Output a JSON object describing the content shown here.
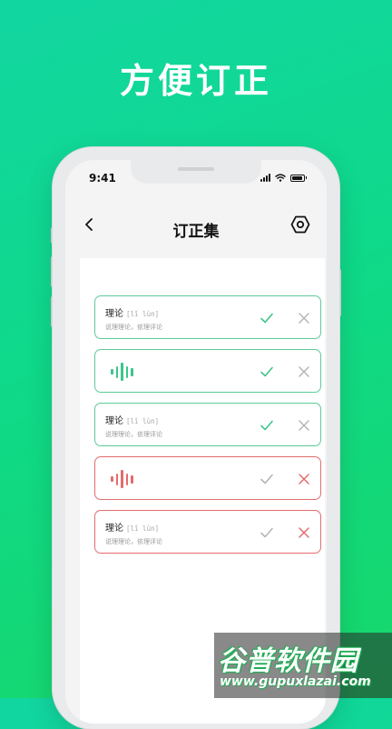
{
  "headline": "方便订正",
  "status_bar": {
    "time": "9:41"
  },
  "nav": {
    "title": "订正集"
  },
  "cards": [
    {
      "type": "word",
      "state": "correct",
      "word": "理论",
      "pinyin": "[lǐ lùn]",
      "definition": "说理理论，依理评论"
    },
    {
      "type": "audio",
      "state": "correct"
    },
    {
      "type": "word",
      "state": "correct",
      "word": "理论",
      "pinyin": "[lǐ lùn]",
      "definition": "说理理论，依理评论"
    },
    {
      "type": "audio",
      "state": "wrong"
    },
    {
      "type": "word",
      "state": "wrong",
      "word": "理论",
      "pinyin": "[lǐ lùn]",
      "definition": "说理理论，依理评论"
    }
  ],
  "icons": {
    "back": "chevron-left-icon",
    "settings": "hexagon-settings-icon",
    "correct": "check-icon",
    "wrong": "close-icon",
    "audio": "sound-wave-icon"
  },
  "colors": {
    "background_start": "#12d6a1",
    "background_end": "#17d86a",
    "correct_accent": "#3cc58a",
    "wrong_accent": "#e46c6c",
    "inactive_icon": "#b5b5b5"
  },
  "watermark": {
    "logo": "谷普软件园",
    "url": "www.gupuxlazai.com"
  }
}
